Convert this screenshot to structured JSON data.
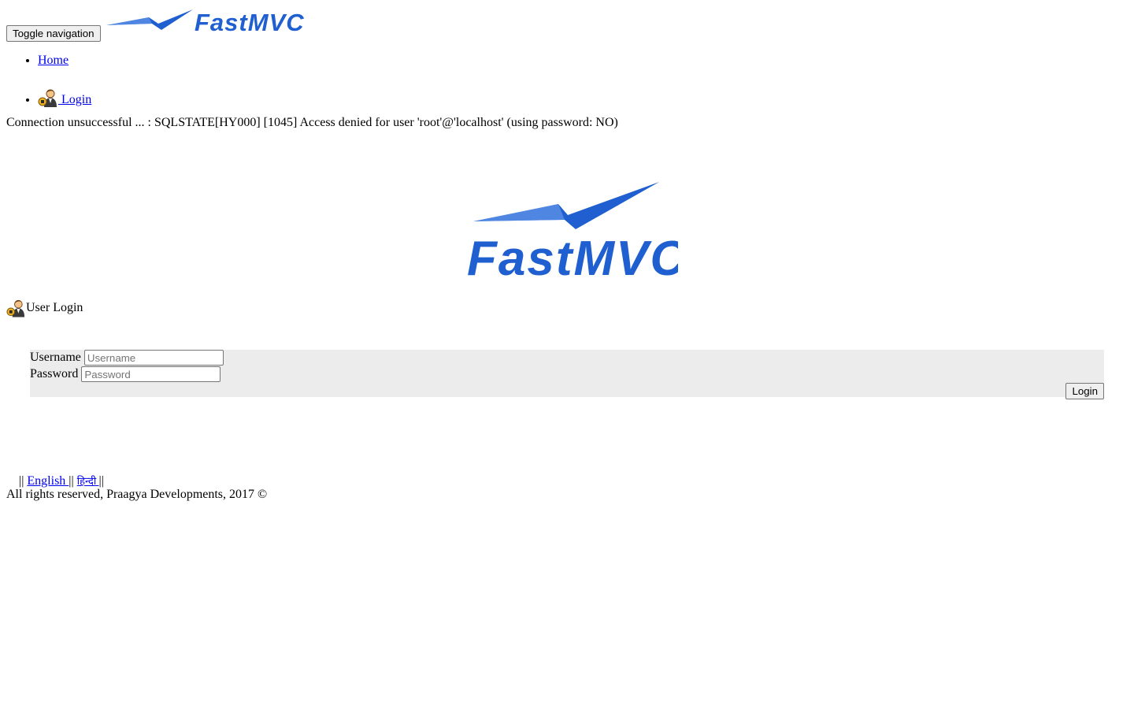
{
  "nav": {
    "toggle_label": "Toggle navigation",
    "brand_logo_text": "FastMVC",
    "items": [
      {
        "label": "Home"
      },
      {
        "label": " Login",
        "icon": "user-icon"
      }
    ]
  },
  "error": {
    "message": "Connection unsuccessful ... : SQLSTATE[HY000] [1045] Access denied for user 'root'@'localhost' (using password: NO)"
  },
  "hero": {
    "logo_text": "FastMVC"
  },
  "login": {
    "heading": "User Login",
    "heading_icon": "user-icon",
    "username_label": "Username",
    "username_placeholder": "Username",
    "password_label": "Password",
    "password_placeholder": "Password",
    "submit_label": "Login"
  },
  "footer": {
    "sep_open": "||",
    "lang_english": "English ",
    "sep_mid": "||",
    "lang_other": "हिन्दी ",
    "sep_close": "||",
    "copyright": "All rights reserved, Praagya Developments, 2017 ©"
  },
  "colors": {
    "logo_blue": "#1f5fcf",
    "panel_bg": "#ececec",
    "link": "#0000ee"
  }
}
